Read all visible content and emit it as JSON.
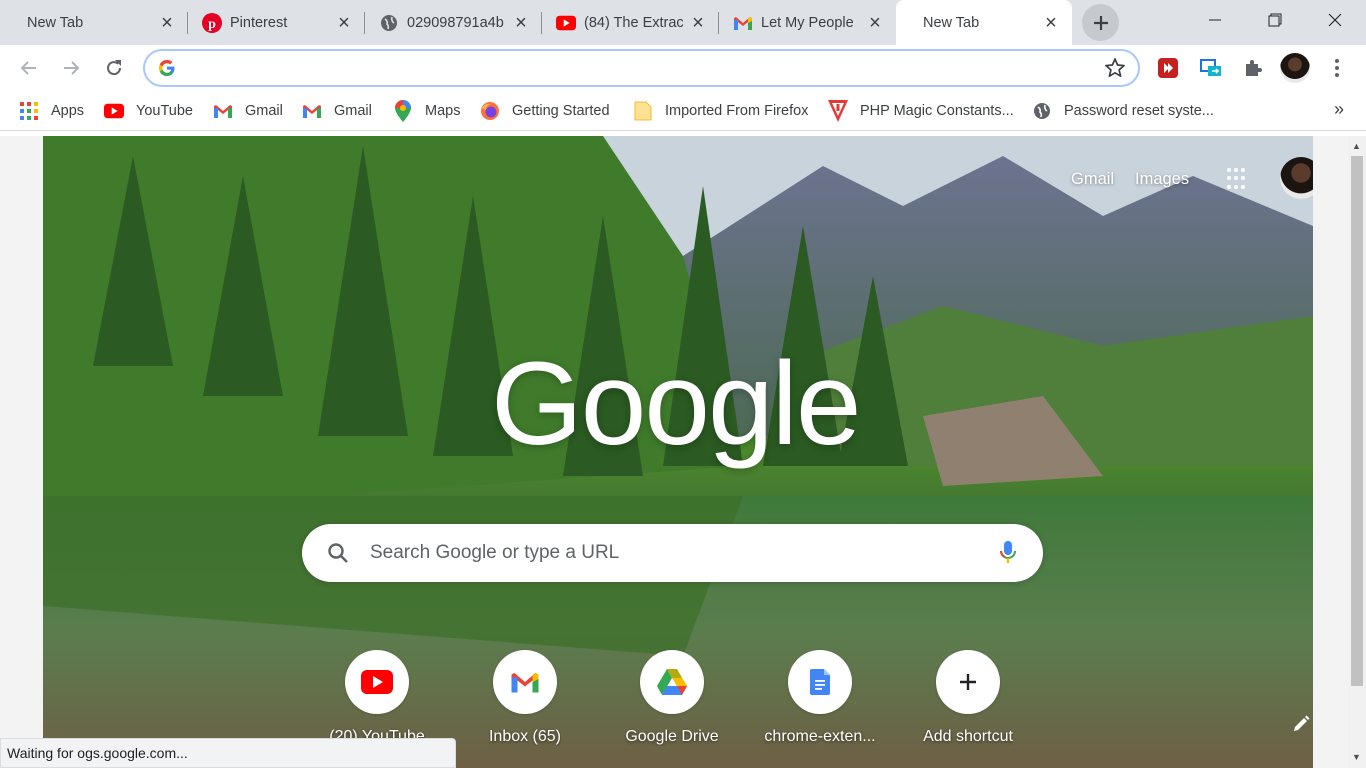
{
  "tabs": [
    {
      "title": "New Tab",
      "icon": "none",
      "active": false
    },
    {
      "title": "Pinterest",
      "icon": "pinterest-icon",
      "active": false
    },
    {
      "title": "029098791a4b",
      "icon": "globe-icon",
      "active": false
    },
    {
      "title": "(84) The Extrac",
      "icon": "youtube-icon",
      "active": false
    },
    {
      "title": "Let My People",
      "icon": "gmail-icon",
      "active": false
    },
    {
      "title": "New Tab",
      "icon": "none",
      "active": true
    }
  ],
  "omnibox": {
    "value": "",
    "placeholder": ""
  },
  "bookmarks": [
    {
      "label": "Apps",
      "icon": "apps-grid-icon"
    },
    {
      "label": "YouTube",
      "icon": "youtube-icon"
    },
    {
      "label": "Gmail",
      "icon": "gmail-icon"
    },
    {
      "label": "Gmail",
      "icon": "gmail-icon"
    },
    {
      "label": "Maps",
      "icon": "maps-pin-icon"
    },
    {
      "label": "Getting Started",
      "icon": "firefox-icon"
    },
    {
      "label": "Imported From Firefox",
      "icon": "folder-icon"
    },
    {
      "label": "PHP Magic Constants...",
      "icon": "php-icon"
    },
    {
      "label": "Password reset syste...",
      "icon": "globe-icon"
    }
  ],
  "ntp": {
    "top_links": {
      "gmail": "Gmail",
      "images": "Images"
    },
    "logo": "Google",
    "search_placeholder": "Search Google or type a URL",
    "shortcuts": [
      {
        "label": "(20) YouTube",
        "icon": "youtube-icon"
      },
      {
        "label": "Inbox (65)",
        "icon": "gmail-icon"
      },
      {
        "label": "Google Drive",
        "icon": "google-drive-icon"
      },
      {
        "label": "chrome-exten...",
        "icon": "google-docs-icon"
      },
      {
        "label": "Add shortcut",
        "icon": "plus-icon"
      }
    ]
  },
  "status": "Waiting for ogs.google.com...",
  "colors": {
    "accent": "#1a73e8",
    "tabstrip": "#dee1e6",
    "youtube": "#ff0000",
    "omnibox_focus": "#a8c7fa"
  }
}
